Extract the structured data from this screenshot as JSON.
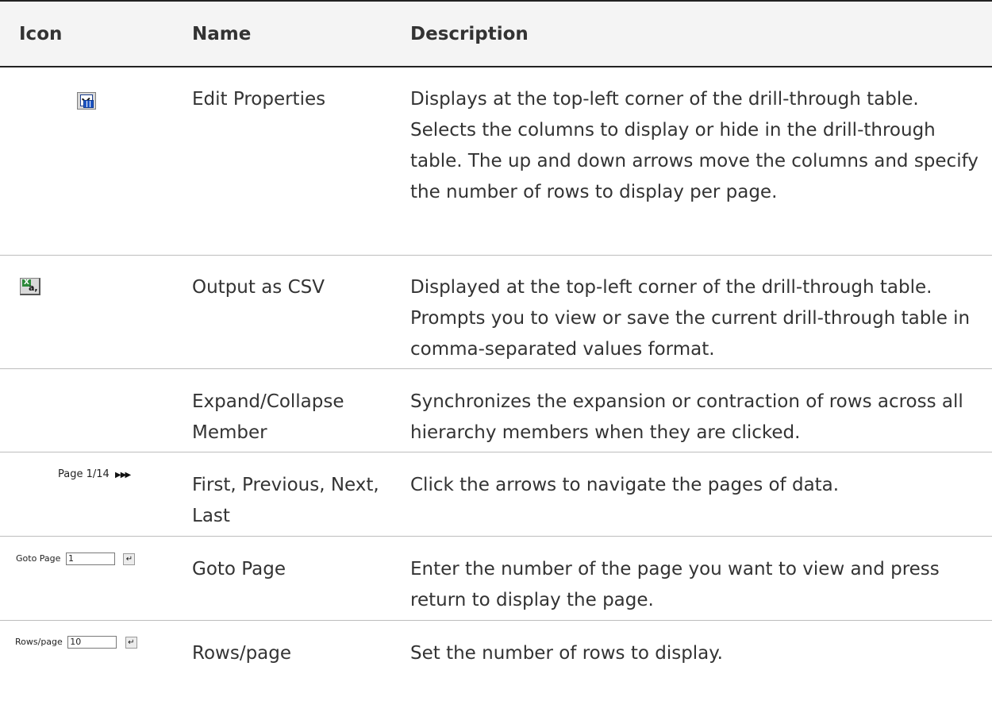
{
  "table": {
    "headers": {
      "icon": "Icon",
      "name": "Name",
      "description": "Description"
    },
    "rows": [
      {
        "icon": "edit-properties-icon",
        "name": "Edit Properties",
        "description": "Displays at the top-left corner of the drill-through table. Selects the columns to display or hide in the drill-through table. The up and down arrows move the columns and specify the number of rows to display per page."
      },
      {
        "icon": "output-csv-icon",
        "name": "Output as CSV",
        "description": "Displayed at the top-left corner of the drill-through table. Prompts you to view or save the current drill-through table in comma-separated values format."
      },
      {
        "icon": "",
        "name": "Expand/Collapse Member",
        "description": "Synchronizes the expansion or contraction of rows across all hierarchy members when they are clicked."
      },
      {
        "icon": "pager-widget",
        "name": "First, Previous, Next, Last",
        "description": "Click the arrows to navigate the pages of data."
      },
      {
        "icon": "goto-page-widget",
        "name": "Goto Page",
        "description": "Enter the number of the page you want to view and press return to display the page."
      },
      {
        "icon": "rows-per-page-widget",
        "name": "Rows/page",
        "description": "Set the number of rows to display."
      }
    ]
  },
  "widgets": {
    "pager": {
      "text": "Page 1/14",
      "arrows": "▶ ▶▶"
    },
    "goto": {
      "label": "Goto Page",
      "value": "1",
      "return_glyph": "↵"
    },
    "rows": {
      "label": "Rows/page",
      "value": "10",
      "return_glyph": "↵"
    }
  }
}
